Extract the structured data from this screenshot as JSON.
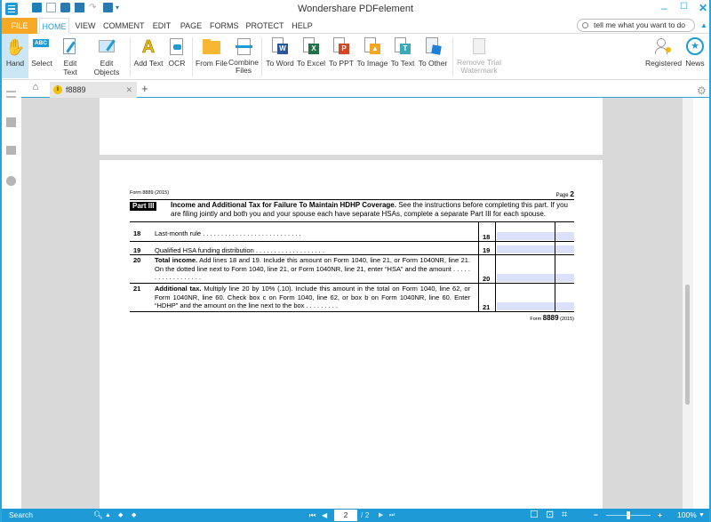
{
  "window": {
    "title": "Wondershare PDFelement",
    "controls": [
      "minimize-icon",
      "maximize-icon",
      "close-icon"
    ]
  },
  "quick_access": [
    "open-folder-icon",
    "save-icon",
    "print-icon",
    "scan-icon",
    "redo-icon",
    "recent-icon",
    "dropdown-icon"
  ],
  "menu_tabs": [
    {
      "label": "FILE"
    },
    {
      "label": "HOME",
      "active": true
    },
    {
      "label": "VIEW"
    },
    {
      "label": "COMMENT"
    },
    {
      "label": "EDIT"
    },
    {
      "label": "PAGE"
    },
    {
      "label": "FORMS"
    },
    {
      "label": "PROTECT"
    },
    {
      "label": "HELP"
    }
  ],
  "search": {
    "placeholder": "tell me what you want to do"
  },
  "ribbon": {
    "buttons": [
      {
        "label": "Hand",
        "icon": "hand-icon",
        "active": true
      },
      {
        "label": "Select",
        "icon": "select-abc-icon"
      },
      {
        "label": "Edit Text",
        "icon": "edit-text-icon"
      },
      {
        "label": "Edit Objects",
        "icon": "edit-objects-icon"
      },
      {
        "label": "Add Text",
        "icon": "add-text-icon"
      },
      {
        "label": "OCR",
        "icon": "ocr-icon"
      },
      {
        "label": "From File",
        "icon": "folder-icon"
      },
      {
        "label": "Combine Files",
        "icon": "combine-files-icon"
      },
      {
        "label": "To Word",
        "icon": "to-word-icon"
      },
      {
        "label": "To Excel",
        "icon": "to-excel-icon"
      },
      {
        "label": "To PPT",
        "icon": "to-ppt-icon"
      },
      {
        "label": "To Image",
        "icon": "to-image-icon"
      },
      {
        "label": "To Text",
        "icon": "to-text-icon"
      },
      {
        "label": "To Other",
        "icon": "to-other-icon"
      },
      {
        "label": "Remove Trial Watermark",
        "icon": "remove-watermark-icon",
        "disabled": true
      },
      {
        "label": "Registered",
        "icon": "registered-user-icon"
      },
      {
        "label": "News",
        "icon": "news-star-icon"
      }
    ]
  },
  "doc_tabs": {
    "home_icon": "home-icon",
    "tabs": [
      {
        "label": "f8889",
        "icon": "info-icon"
      }
    ],
    "add_label": "+"
  },
  "document": {
    "form_header": "Form 8889 (2015)",
    "page_label": "Page",
    "page_number": "2",
    "part": {
      "label": "Part III",
      "title": "Income and Additional Tax for Failure To Maintain HDHP Coverage.",
      "text": "See the instructions  before completing this part. If you are filing jointly and both you and your spouse each have separate HSAs, complete a separate Part III for each spouse."
    },
    "lines": [
      {
        "num": "18",
        "bold": "",
        "text": "Last-month rule . . . . . . . . . . . . . . . . . . . . . . . . . . ."
      },
      {
        "num": "19",
        "bold": "",
        "text": "Qualified HSA funding distribution . . . . . . . . . . . . . . . . . . ."
      },
      {
        "num": "20",
        "bold": "Total income.",
        "text": " Add lines 18 and 19. Include this amount on Form 1040, line 21, or Form 1040NR, line 21. On the dotted line next to Form 1040, line 21, or Form 1040NR, line 21, enter “HSA” and the amount . . . . . . . . . . . . . . . . . ."
      },
      {
        "num": "21",
        "bold": "Additional tax.",
        "text": " Multiply line 20 by 10% (.10). Include this amount in the total on Form 1040, line 62, or Form 1040NR, line 60. Check box c on Form 1040, line 62, or box b on Form 1040NR, line 60. Enter “HDHP” and the amount on the line next to the box . . . . . . . . ."
      }
    ],
    "footer_prefix": "Form",
    "footer_form": "8889",
    "footer_year": "(2015)"
  },
  "statusbar": {
    "search_label": "Search",
    "current_page": "2",
    "total_pages": "/ 2",
    "zoom": "100%",
    "zoom_fraction": 0.5
  },
  "colors": {
    "accent": "#1e9bd7",
    "file_tab": "#f7a925",
    "field_fill": "#dbe0fb"
  }
}
